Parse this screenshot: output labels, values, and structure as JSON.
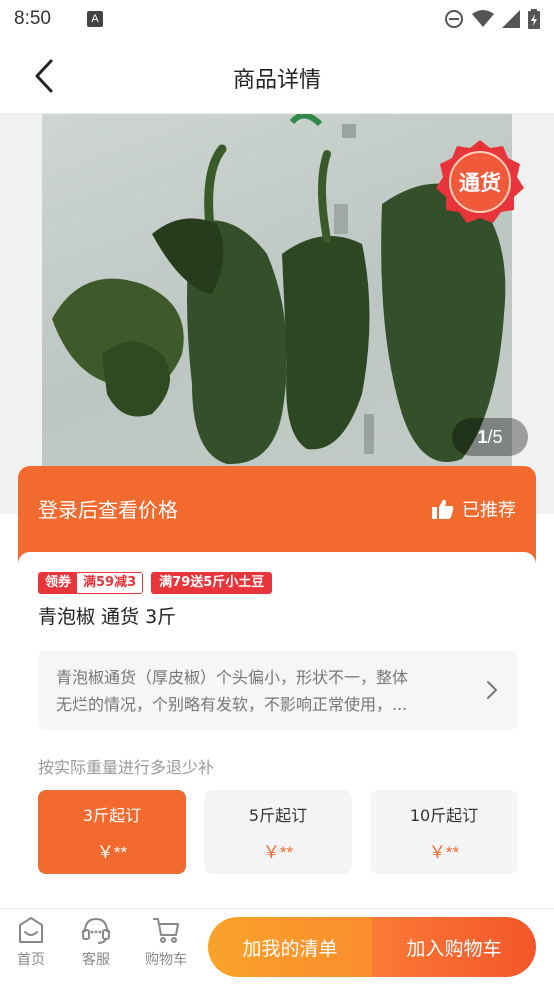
{
  "status_bar": {
    "time": "8:50",
    "notification_icon_label": "A",
    "icons": [
      "do-not-disturb-icon",
      "wifi-icon",
      "signal-icon",
      "battery-icon"
    ]
  },
  "header": {
    "title": "商品详情",
    "back_icon": "chevron-left-icon"
  },
  "gallery": {
    "badge": "通货",
    "pager_current": "1",
    "pager_total": "/5"
  },
  "price_bar": {
    "login_text": "登录后查看价格",
    "recommend_text": "已推荐",
    "recommend_icon": "thumbs-up-icon"
  },
  "product": {
    "coupon_left": "领券",
    "coupon_right": "满59减3",
    "promo": "满79送5斤小土豆",
    "name": "青泡椒 通货 3斤",
    "desc_line1": "青泡椒通货（厚皮椒）个头偏小，形状不一，整体",
    "desc_line2": "无烂的情况，个别略有发软，不影响正常使用，...",
    "weight_note": "按实际重量进行多退少补",
    "specs": [
      {
        "name": "3斤起订",
        "price": "￥**",
        "active": true
      },
      {
        "name": "5斤起订",
        "price": "￥**",
        "active": false
      },
      {
        "name": "10斤起订",
        "price": "￥**",
        "active": false
      }
    ]
  },
  "bottom_nav": {
    "home": "首页",
    "service": "客服",
    "cart": "购物车",
    "add_list": "加我的清单",
    "add_cart": "加入购物车"
  },
  "colors": {
    "accent": "#f36a2f",
    "coupon_red": "#e8343b",
    "list_button": "#f9a32b"
  }
}
